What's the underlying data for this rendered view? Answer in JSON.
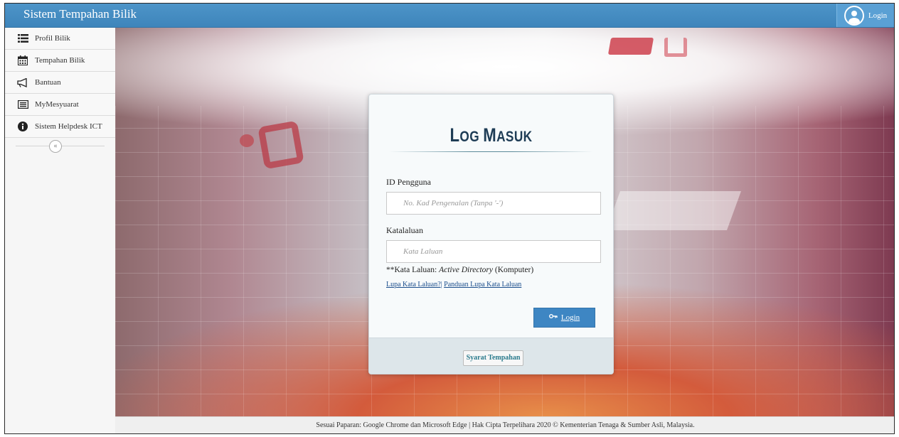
{
  "header": {
    "title": "Sistem Tempahan Bilik",
    "login_label": "Login"
  },
  "sidebar": {
    "items": [
      {
        "label": "Profil Bilik",
        "icon": "list-icon"
      },
      {
        "label": "Tempahan Bilik",
        "icon": "calendar-icon"
      },
      {
        "label": "Bantuan",
        "icon": "megaphone-icon"
      },
      {
        "label": "MyMesyuarat",
        "icon": "document-list-icon"
      },
      {
        "label": "Sistem Helpdesk ICT",
        "icon": "info-icon"
      }
    ],
    "collapse_symbol": "«"
  },
  "login_card": {
    "title_big1": "L",
    "title_small1": "OG ",
    "title_big2": "M",
    "title_small2": "ASUK",
    "user_label": "ID Pengguna",
    "user_placeholder": "No. Kad Pengenalan (Tanpa '-')",
    "pass_label": "Katalaluan",
    "pass_placeholder": "Kata Laluan",
    "note_prefix": "**Kata Laluan: ",
    "note_italic": "Active Directory",
    "note_suffix": " (Komputer)",
    "link_forgot": "Lupa Kata Laluan?|",
    "link_guide": "Panduan Lupa Kata Laluan",
    "login_button": "Login",
    "terms_button": "Syarat Tempahan"
  },
  "footer": {
    "text": "Sesuai Paparan: Google Chrome dan Microsoft Edge | Hak Cipta Terpelihara 2020 © Kementerian Tenaga & Sumber Asli, Malaysia."
  },
  "colors": {
    "header_blue": "#4d94c8",
    "button_blue": "#3e86c3",
    "title_navy": "#1e3c55"
  }
}
